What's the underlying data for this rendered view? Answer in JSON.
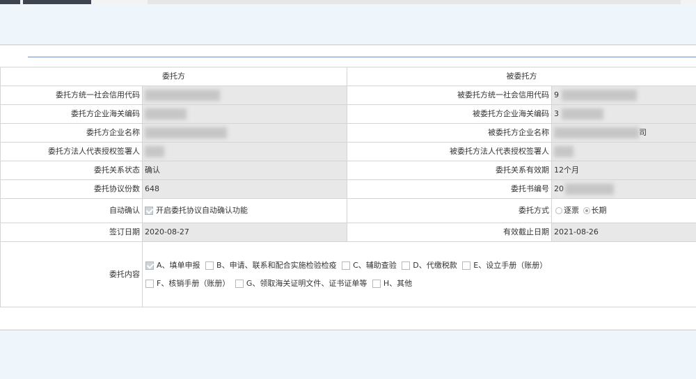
{
  "header": {
    "client_title": "委托方",
    "agent_title": "被委托方"
  },
  "rows": {
    "client_credit_code_label": "委托方统一社会信用代码",
    "agent_credit_code_label": "被委托方统一社会信用代码",
    "agent_credit_code_value": "9",
    "client_customs_code_label": "委托方企业海关编码",
    "agent_customs_code_label": "被委托方企业海关编码",
    "agent_customs_code_value": "3",
    "client_name_label": "委托方企业名称",
    "agent_name_label": "被委托方企业名称",
    "agent_name_value_tail": "司",
    "client_rep_label": "委托方法人代表授权签署人",
    "agent_rep_label": "被委托方法人代表授权签署人",
    "relation_status_label": "委托关系状态",
    "relation_status_value": "确认",
    "relation_validity_label": "委托关系有效期",
    "relation_validity_value": "12个月",
    "protocol_count_label": "委托协议份数",
    "protocol_count_value": "648",
    "letter_number_label": "委托书编号",
    "letter_number_value": "20",
    "auto_confirm_label": "自动确认",
    "auto_confirm_text": "开启委托协议自动确认功能",
    "auto_confirm_checked": true,
    "method_label": "委托方式",
    "method_options": [
      "逐票",
      "长期"
    ],
    "method_selected": "长期",
    "sign_date_label": "签订日期",
    "sign_date_value": "2020-08-27",
    "expiry_date_label": "有效截止日期",
    "expiry_date_value": "2021-08-26"
  },
  "content": {
    "label": "委托内容",
    "options": [
      {
        "text": "A、填单申报",
        "checked": true
      },
      {
        "text": "B、申请、联系和配合实施检验检疫",
        "checked": false
      },
      {
        "text": "C、辅助查验",
        "checked": false
      },
      {
        "text": "D、代缴税款",
        "checked": false
      },
      {
        "text": "E、设立手册（账册）",
        "checked": false
      },
      {
        "text": "F、核销手册（账册）",
        "checked": false
      },
      {
        "text": "G、领取海关证明文件、证书证单等",
        "checked": false
      },
      {
        "text": "H、其他",
        "checked": false
      }
    ]
  },
  "colors": {
    "page_bg": "#eef6fb",
    "readonly_bg": "#e8e8e8",
    "divider": "#a9c4e6",
    "tab_dark": "#3d4450"
  }
}
